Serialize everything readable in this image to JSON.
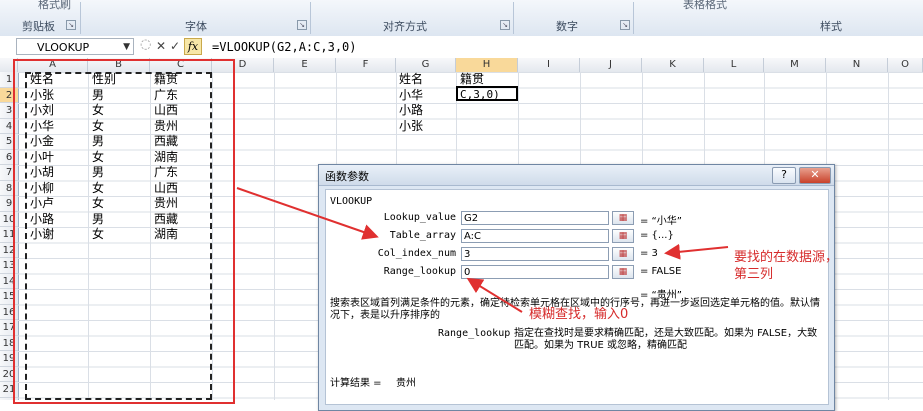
{
  "ribbon": {
    "top_cut_left": "格式刷",
    "top_cut_right": "表格格式",
    "groups": [
      "剪贴板",
      "字体",
      "对齐方式",
      "数字",
      "样式"
    ]
  },
  "formula_bar": {
    "name_box": "VLOOKUP",
    "cancel_symbol": "✕",
    "enter_symbol": "✓",
    "fx_label": "fx",
    "formula": "=VLOOKUP(G2,A:C,3,0)"
  },
  "columns": [
    "A",
    "B",
    "C",
    "D",
    "E",
    "F",
    "G",
    "H",
    "I",
    "J",
    "K",
    "L",
    "M",
    "N",
    "O"
  ],
  "rows": [
    "1",
    "2",
    "3",
    "4",
    "5",
    "6",
    "7",
    "8",
    "9",
    "10",
    "11",
    "12",
    "13",
    "14",
    "15",
    "16",
    "17",
    "18",
    "19",
    "20",
    "21"
  ],
  "table": {
    "headers": [
      "姓名",
      "性别",
      "籍贯"
    ],
    "rows": [
      [
        "小张",
        "男",
        "广东"
      ],
      [
        "小刘",
        "女",
        "山西"
      ],
      [
        "小华",
        "女",
        "贵州"
      ],
      [
        "小金",
        "男",
        "西藏"
      ],
      [
        "小叶",
        "女",
        "湖南"
      ],
      [
        "小胡",
        "男",
        "广东"
      ],
      [
        "小柳",
        "女",
        "山西"
      ],
      [
        "小卢",
        "女",
        "贵州"
      ],
      [
        "小路",
        "男",
        "西藏"
      ],
      [
        "小谢",
        "女",
        "湖南"
      ]
    ]
  },
  "lookup": {
    "header_name": "姓名",
    "header_origin": "籍贯",
    "names": [
      "小华",
      "小路",
      "小张"
    ],
    "active_cell_value": "C,3,0)"
  },
  "dialog": {
    "title": "函数参数",
    "help_button": "?",
    "close_button": "✕",
    "function_name": "VLOOKUP",
    "args": [
      {
        "label": "Lookup_value",
        "value": "G2",
        "result": "= “小华”"
      },
      {
        "label": "Table_array",
        "value": "A:C",
        "result": "= {...}"
      },
      {
        "label": "Col_index_num",
        "value": "3",
        "result": "= 3"
      },
      {
        "label": "Range_lookup",
        "value": "0",
        "result": "= FALSE"
      }
    ],
    "total_result": "= “贵州”",
    "description": "搜索表区域首列满足条件的元素，确定待检索单元格在区域中的行序号，再进一步返回选定单元格的值。默认情况下，表是以升序排序的",
    "arg_name": "Range_lookup",
    "arg_description": "指定在查找时是要求精确匹配，还是大致匹配。如果为 FALSE，大致匹配。如果为 TRUE 或忽略，精确匹配",
    "calc_result_label": "计算结果 =",
    "calc_result_value": "贵州"
  },
  "annotations": {
    "fuzzy": "模糊查找，输入0",
    "col_note_1": "要找的在数据源，",
    "col_note_2": "第三列"
  },
  "colors": {
    "annotation": "#d62b2b",
    "selected_header": "#f9d99a"
  }
}
